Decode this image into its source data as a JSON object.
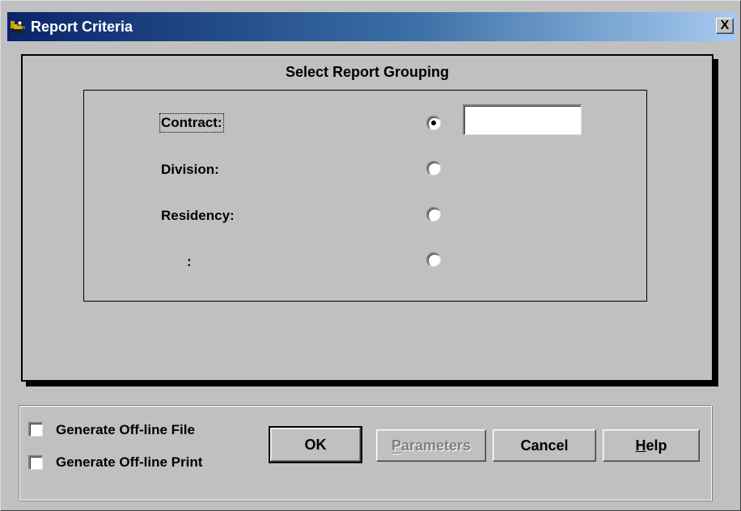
{
  "window": {
    "title": "Report Criteria",
    "close_label": "X"
  },
  "grouping": {
    "title": "Select Report Grouping",
    "options": [
      {
        "label": "Contract:",
        "selected": true
      },
      {
        "label": "Division:",
        "selected": false
      },
      {
        "label": "Residency:",
        "selected": false
      },
      {
        "label": ":",
        "selected": false
      }
    ],
    "contract_value": ""
  },
  "options": {
    "offline_file_label": "Generate Off-line File",
    "offline_file_checked": false,
    "offline_print_label": "Generate Off-line Print",
    "offline_print_checked": false
  },
  "buttons": {
    "ok": "OK",
    "parameters": "Parameters",
    "cancel": "Cancel",
    "help": "Help"
  },
  "colors": {
    "title_start": "#0a246a",
    "title_end": "#a6caf0",
    "face": "#c0c0c0"
  },
  "icons": {
    "title": "bulldozer-icon"
  }
}
